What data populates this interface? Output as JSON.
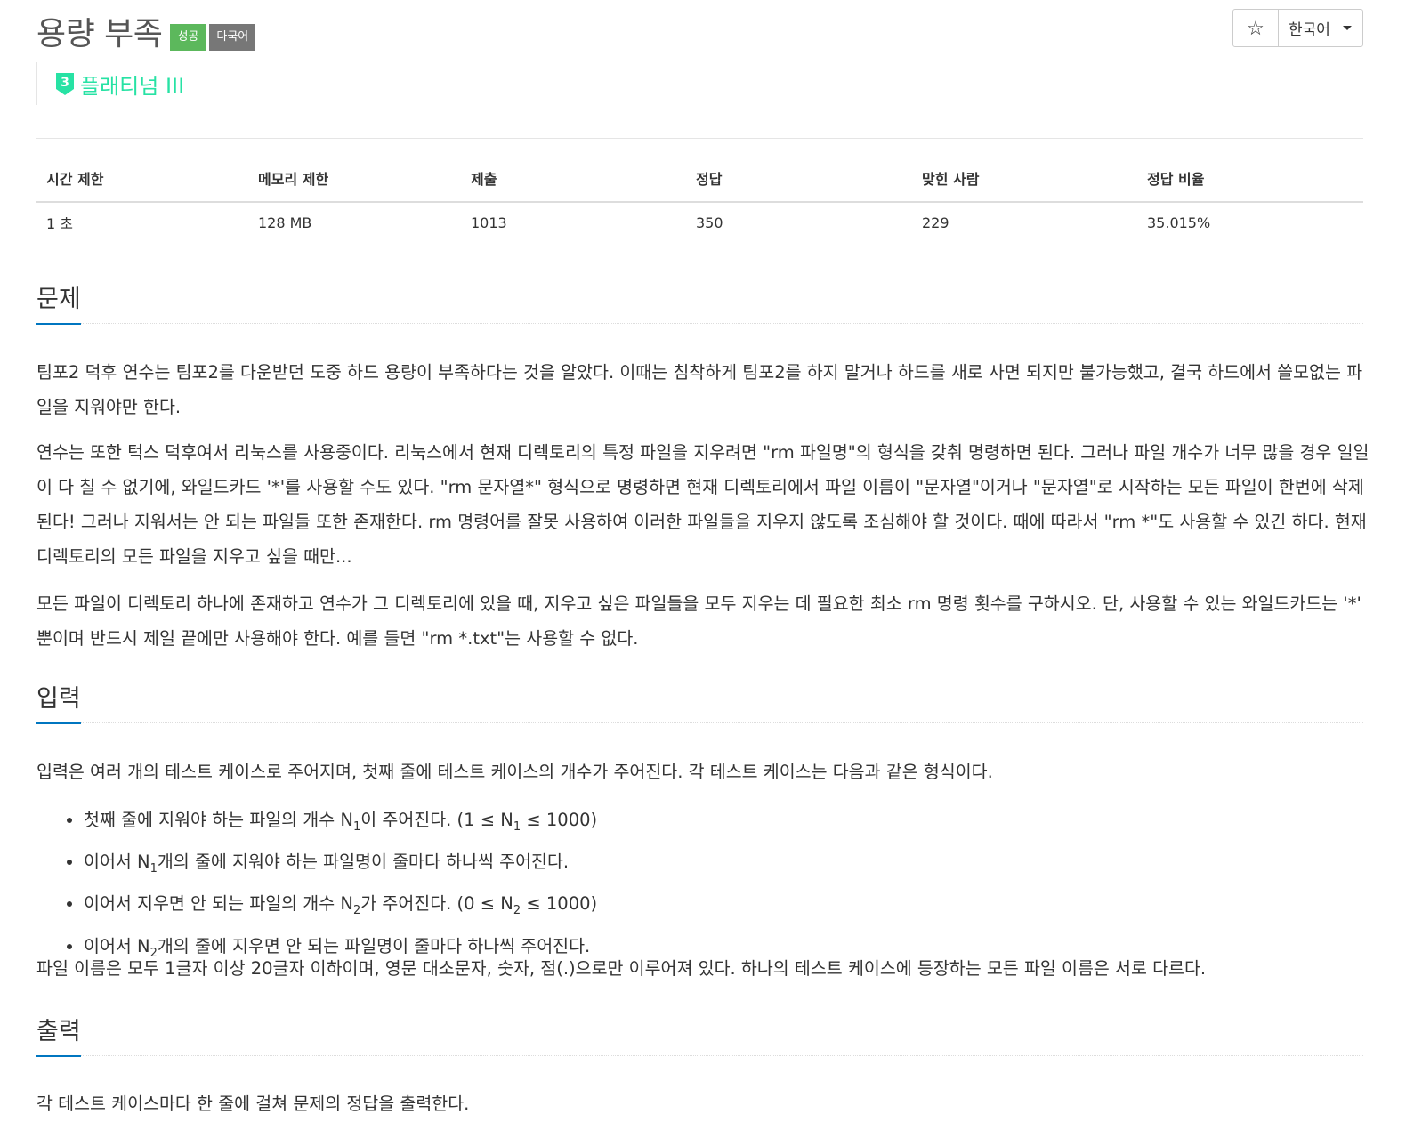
{
  "header": {
    "title": "용량 부족",
    "badges": {
      "success": "성공",
      "multilang": "다국어"
    },
    "tier": {
      "level": "3",
      "name": "플래티넘 III",
      "color": "#27e2a4"
    },
    "star_icon": "star-icon",
    "language": "한국어"
  },
  "info": {
    "headers": [
      "시간 제한",
      "메모리 제한",
      "제출",
      "정답",
      "맞힌 사람",
      "정답 비율"
    ],
    "values": [
      "1 초",
      "128 MB",
      "1013",
      "350",
      "229",
      "35.015%"
    ]
  },
  "problem": {
    "heading": "문제",
    "paragraphs": [
      "팀포2 덕후 연수는 팀포2를 다운받던 도중 하드 용량이 부족하다는 것을 알았다. 이때는 침착하게 팀포2를 하지 말거나 하드를 새로 사면 되지만 불가능했고, 결국 하드에서 쓸모없는 파일을 지워야만 한다.",
      "연수는 또한 턱스 덕후여서 리눅스를 사용중이다. 리눅스에서 현재 디렉토리의 특정 파일을 지우려면 \"rm 파일명\"의 형식을 갖춰 명령하면 된다. 그러나 파일 개수가 너무 많을 경우 일일이 다 칠 수 없기에, 와일드카드 '*'를 사용할 수도 있다. \"rm 문자열*\" 형식으로 명령하면 현재 디렉토리에서 파일 이름이 \"문자열\"이거나 \"문자열\"로 시작하는 모든 파일이 한번에 삭제된다! 그러나 지워서는 안 되는 파일들 또한 존재한다. rm 명령어를 잘못 사용하여 이러한 파일들을 지우지 않도록 조심해야 할 것이다. 때에 따라서 \"rm *\"도 사용할 수 있긴 하다. 현재 디렉토리의 모든 파일을 지우고 싶을 때만...",
      "모든 파일이 디렉토리 하나에 존재하고 연수가 그 디렉토리에 있을 때, 지우고 싶은 파일들을 모두 지우는 데 필요한 최소 rm 명령 횟수를 구하시오. 단, 사용할 수 있는 와일드카드는 '*' 뿐이며 반드시 제일 끝에만 사용해야 한다. 예를 들면 \"rm *.txt\"는 사용할 수 없다."
    ]
  },
  "input": {
    "heading": "입력",
    "intro": "입력은 여러 개의 테스트 케이스로 주어지며, 첫째 줄에 테스트 케이스의 개수가 주어진다. 각 테스트 케이스는 다음과 같은 형식이다.",
    "items": [
      {
        "a": "첫째 줄에 지워야 하는 파일의 개수 N",
        "s1": "1",
        "b": "이 주어진다. (1 ≤ N",
        "s2": "1",
        "c": " ≤ 1000)"
      },
      {
        "a": "이어서 N",
        "s1": "1",
        "b": "개의 줄에 지워야 하는 파일명이 줄마다 하나씩 주어진다."
      },
      {
        "a": "이어서 지우면 안 되는 파일의 개수 N",
        "s1": "2",
        "b": "가 주어진다. (0 ≤ N",
        "s2": "2",
        "c": " ≤ 1000)"
      },
      {
        "a": "이어서 N",
        "s1": "2",
        "b": "개의 줄에 지우면 안 되는 파일명이 줄마다 하나씩 주어진다."
      }
    ],
    "outro": "파일 이름은 모두 1글자 이상 20글자 이하이며, 영문 대소문자, 숫자, 점(.)으로만 이루어져 있다. 하나의 테스트 케이스에 등장하는 모든 파일 이름은 서로 다르다."
  },
  "output": {
    "heading": "출력",
    "text": "각 테스트 케이스마다 한 줄에 걸쳐 문제의 정답을 출력한다."
  }
}
